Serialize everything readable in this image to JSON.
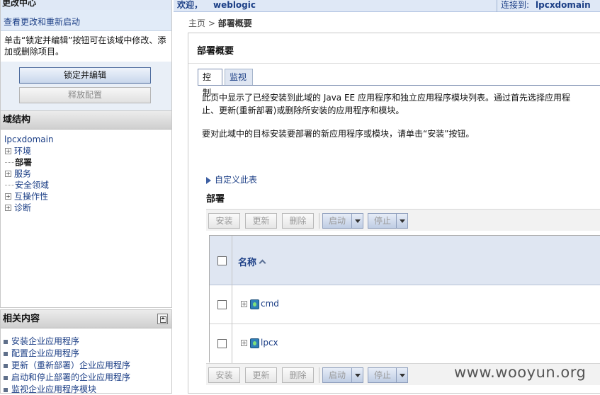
{
  "change_center": {
    "title": "更改中心",
    "view_link": "查看更改和重新启动",
    "description": "单击“锁定并编辑”按钮可在该域中修改、添加或删除项目。",
    "lock_button": "锁定并编辑",
    "release_button": "释放配置"
  },
  "domain_structure": {
    "title": "域结构",
    "root": "lpcxdomain",
    "items": [
      {
        "label": "环境",
        "expandable": true
      },
      {
        "label": "部署",
        "expandable": false,
        "selected": true
      },
      {
        "label": "服务",
        "expandable": true
      },
      {
        "label": "安全领域",
        "expandable": false
      },
      {
        "label": "互操作性",
        "expandable": true
      },
      {
        "label": "诊断",
        "expandable": true
      }
    ]
  },
  "related": {
    "title": "相关内容",
    "items": [
      "安装企业应用程序",
      "配置企业应用程序",
      "更新（重新部署）企业应用程序",
      "启动和停止部署的企业应用程序",
      "监视企业应用程序模块"
    ]
  },
  "topbar": {
    "welcome": "欢迎，",
    "user": "weblogic",
    "connected_label": "连接到:",
    "connected_domain": "lpcxdomain"
  },
  "breadcrumb": {
    "home": "主页",
    "separator": " > ",
    "current": "部署概要"
  },
  "main": {
    "title": "部署概要",
    "tabs": [
      "控制",
      "监视"
    ],
    "description_line1": "此页中显示了已经安装到此域的 Java EE 应用程序和独立应用程序模块列表。通过首先选择应用程",
    "description_line2": "止、更新(重新部署)或删除所安装的应用程序和模块。",
    "install_hint": "要对此域中的目标安装要部署的新应用程序或模块，请单击“安装”按钮。",
    "customize_link": "自定义此表",
    "section_title": "部署",
    "toolbar": {
      "install": "安装",
      "update": "更新",
      "delete": "删除",
      "start": "启动",
      "stop": "停止"
    },
    "table": {
      "column_name": "名称",
      "rows": [
        {
          "name": "cmd"
        },
        {
          "name": "lpcx"
        }
      ]
    }
  },
  "watermark": "www.wooyun.org"
}
